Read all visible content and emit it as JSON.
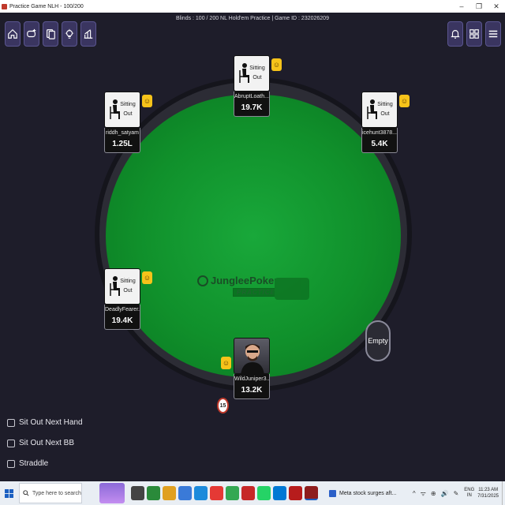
{
  "window": {
    "title": "Practice Game NLH - 100/200",
    "controls": [
      "–",
      "❐",
      "✕"
    ]
  },
  "header": {
    "blinds_info": "Blinds : 100 / 200  NL Hold'em Practice | Game ID : 232026209"
  },
  "toolbar_left": [
    {
      "icon": "home-icon"
    },
    {
      "icon": "add-table-icon"
    },
    {
      "icon": "cards-icon"
    },
    {
      "icon": "lightbulb-icon"
    },
    {
      "icon": "stats-icon"
    }
  ],
  "toolbar_right": [
    {
      "icon": "bell-icon"
    },
    {
      "icon": "grid-icon"
    },
    {
      "icon": "menu-icon"
    }
  ],
  "table": {
    "brand": "JungleePoker",
    "mode": "PRACTICE"
  },
  "seats": [
    {
      "id": "top",
      "name": "AbruptLoath...",
      "stack": "19.7K",
      "status": [
        "Sitting",
        "Out"
      ]
    },
    {
      "id": "top-left",
      "name": "riddh_satyam",
      "stack": "1.25L",
      "status": [
        "Sitting",
        "Out"
      ]
    },
    {
      "id": "top-right",
      "name": "icehunt3878...",
      "stack": "5.4K",
      "status": [
        "Sitting",
        "Out"
      ]
    },
    {
      "id": "left",
      "name": "DeadlyFearer...",
      "stack": "19.4K",
      "status": [
        "Sitting",
        "Out"
      ]
    },
    {
      "id": "hero",
      "name": "WildJuniper3...",
      "stack": "13.2K",
      "status": []
    }
  ],
  "empty_seat": {
    "label": "Empty"
  },
  "timer": {
    "value": "15"
  },
  "options": [
    {
      "label": "Sit Out Next Hand"
    },
    {
      "label": "Sit Out Next BB"
    },
    {
      "label": "Straddle"
    }
  ],
  "taskbar": {
    "search_placeholder": "Type here to search",
    "news": "Meta stock surges aft...",
    "lang": [
      "ENG",
      "IN"
    ],
    "time": "11:23 AM",
    "date": "7/31/2025",
    "tray_symbols": [
      "^",
      "ᯤ",
      "⊕",
      "🔊",
      "✎"
    ]
  },
  "colors": {
    "felt": "#10902b",
    "toolbar_button": "#3a3560",
    "smiley": "#f6c31a"
  }
}
